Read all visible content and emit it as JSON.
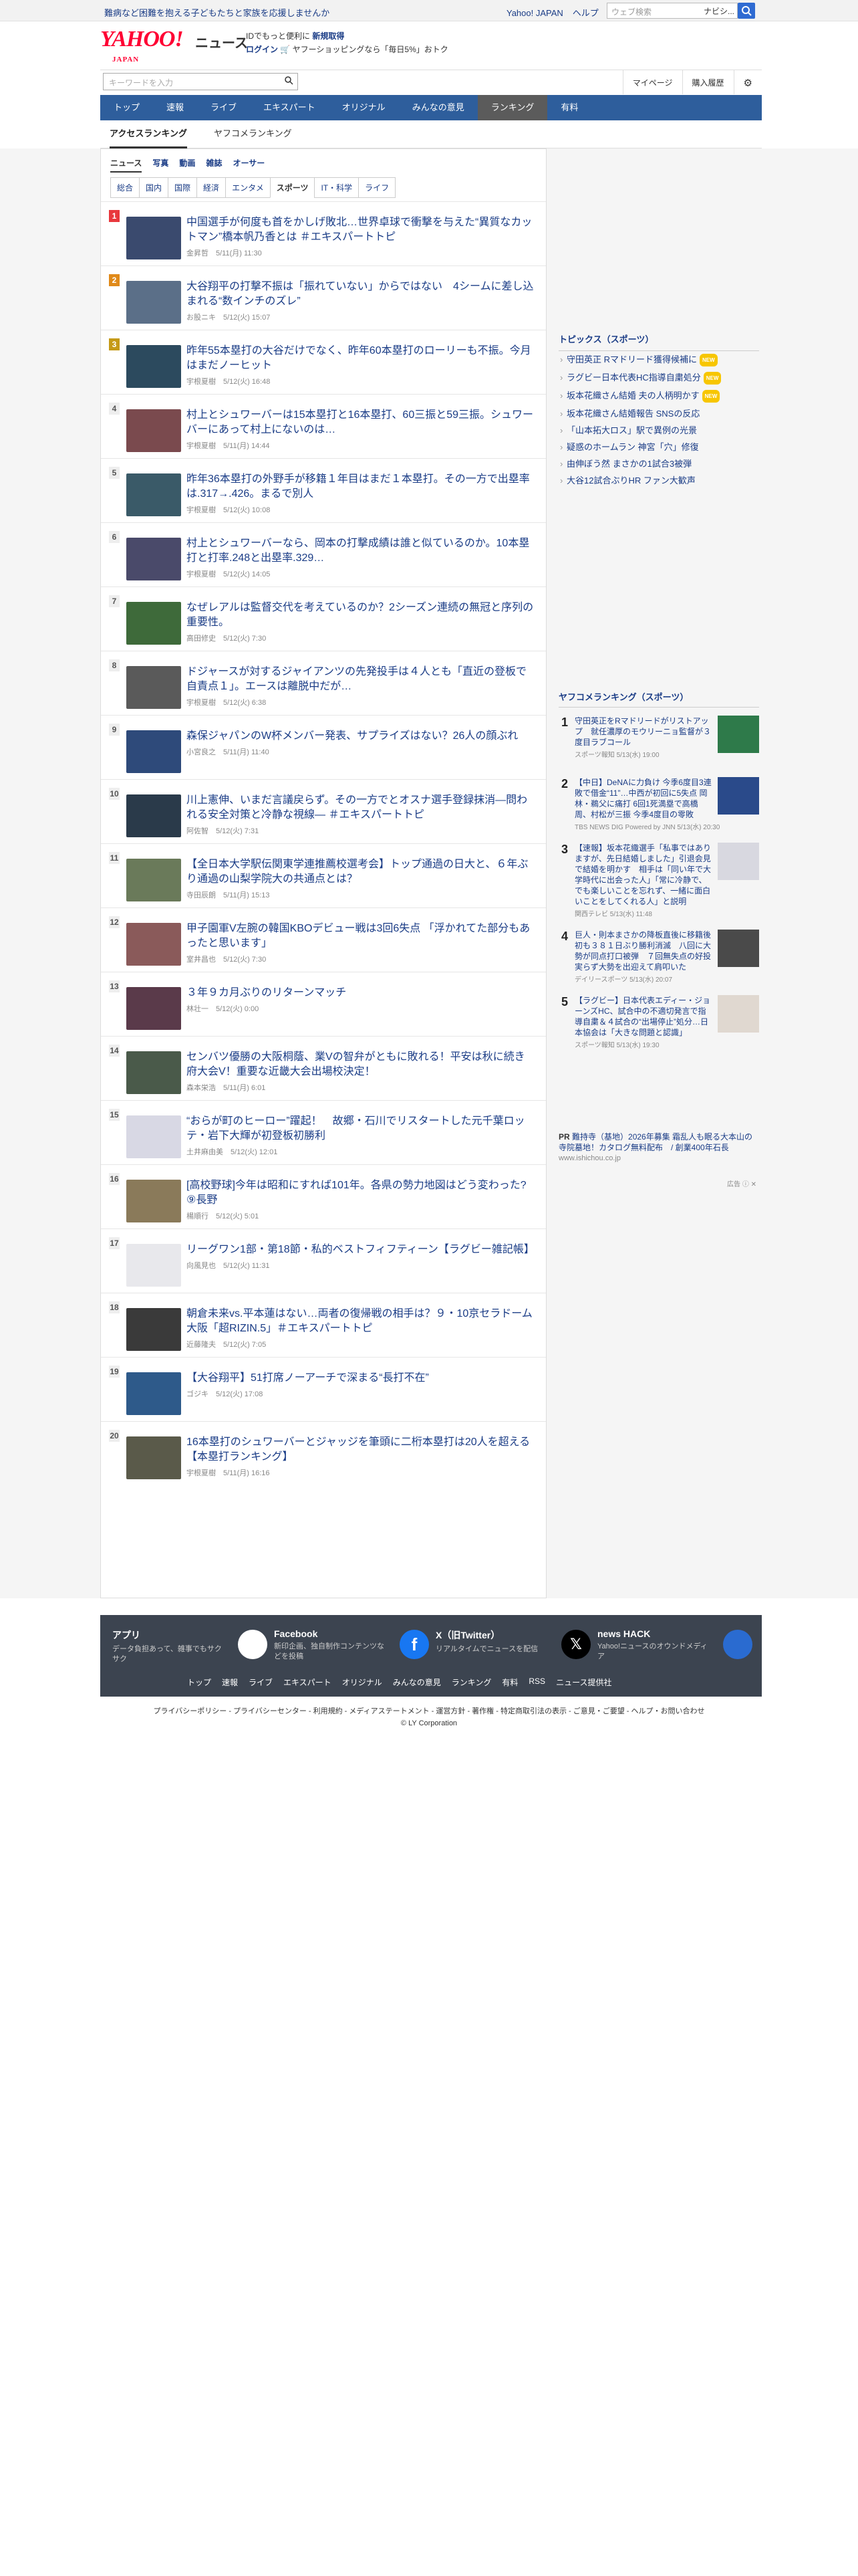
{
  "topbar": {
    "promo": "難病など困難を抱える子どもたちと家族を応援しませんか",
    "links": [
      "Yahoo! JAPAN",
      "ヘルプ"
    ],
    "search_placeholder": "ウェブ検索",
    "navi": "ナビシ..."
  },
  "header": {
    "logo": "YAHOO!",
    "logo_sub": "JAPAN",
    "news": "ニュース",
    "line1": "IDでもっと便利に",
    "line1b": "新規取得",
    "line2a": "ログイン",
    "line2b": "ヤフーショッピングなら「毎日5%」おトク"
  },
  "search": {
    "placeholder": "キーワードを入力",
    "mypage": "マイページ",
    "history": "購入履歴"
  },
  "nav": [
    "トップ",
    "速報",
    "ライブ",
    "エキスパート",
    "オリジナル",
    "みんなの意見",
    "ランキング",
    "有料"
  ],
  "subnav": [
    "アクセスランキング",
    "ヤフコメランキング"
  ],
  "rank_tabs": [
    "ニュース",
    "写真",
    "動画",
    "雑誌",
    "オーサー"
  ],
  "categories": [
    "総合",
    "国内",
    "国際",
    "経済",
    "エンタメ",
    "スポーツ",
    "IT・科学",
    "ライフ"
  ],
  "items": [
    {
      "n": "1",
      "t": "中国選手が何度も首をかしげ敗北…世界卓球で衝撃を与えた“異質なカットマン”橋本帆乃香とは ＃エキスパートトピ",
      "m": "金昇哲　5/11(月) 11:30",
      "c": "#3a4a6e"
    },
    {
      "n": "2",
      "t": "大谷翔平の打撃不振は「振れていない」からではない　4シームに差し込まれる“数インチのズレ”",
      "m": "お股ニキ　5/12(火) 15:07",
      "c": "#5b6f88"
    },
    {
      "n": "3",
      "t": "昨年55本塁打の大谷だけでなく、昨年60本塁打のローリーも不振。今月はまだノーヒット",
      "m": "宇根夏樹　5/12(火) 16:48",
      "c": "#2c4a5e"
    },
    {
      "n": "4",
      "t": "村上とシュワーバーは15本塁打と16本塁打、60三振と59三振。シュワーバーにあって村上にないのは…",
      "m": "宇根夏樹　5/11(月) 14:44",
      "c": "#7a4a4e"
    },
    {
      "n": "5",
      "t": "昨年36本塁打の外野手が移籍１年目はまだ１本塁打。その一方で出塁率は.317→.426。まるで別人",
      "m": "宇根夏樹　5/12(火) 10:08",
      "c": "#3a5a68"
    },
    {
      "n": "6",
      "t": "村上とシュワーバーなら、岡本の打撃成績は誰と似ているのか。10本塁打と打率.248と出塁率.329…",
      "m": "宇根夏樹　5/12(火) 14:05",
      "c": "#4a4a6a"
    },
    {
      "n": "7",
      "t": "なぜレアルは監督交代を考えているのか？2シーズン連続の無冠と序列の重要性。",
      "m": "高田修史　5/12(火) 7:30",
      "c": "#3e6a3a"
    },
    {
      "n": "8",
      "t": "ドジャースが対するジャイアンツの先発投手は４人とも「直近の登板で自責点１」。エースは離脱中だが…",
      "m": "宇根夏樹　5/12(火) 6:38",
      "c": "#5a5a5a"
    },
    {
      "n": "9",
      "t": "森保ジャパンのW杯メンバー発表、サプライズはない？26人の顔ぶれ",
      "m": "小宮良之　5/11(月) 11:40",
      "c": "#2e4a7a"
    },
    {
      "n": "10",
      "t": "川上憲伸、いまだ言議戻らず。その一方でとオスナ選手登録抹消―問われる安全対策と冷静な視線― ＃エキスパートトピ",
      "m": "阿佐智　5/12(火) 7:31",
      "c": "#2a3a4a"
    },
    {
      "n": "11",
      "t": "【全日本大学駅伝関東学連推薦校選考会】トップ通過の日大と、６年ぶり通過の山梨学院大の共通点とは？",
      "m": "寺田辰朗　5/11(月) 15:13",
      "c": "#6a7a5a"
    },
    {
      "n": "12",
      "t": "甲子園軍V左腕の韓国KBOデビュー戦は3回6失点 「浮かれてた部分もあったと思います」",
      "m": "室井昌也　5/12(火) 7:30",
      "c": "#8a5a5a"
    },
    {
      "n": "13",
      "t": "３年９カ月ぶりのリターンマッチ",
      "m": "林壮一　5/12(火) 0:00",
      "c": "#5a3a4a"
    },
    {
      "n": "14",
      "t": "センバツ優勝の大阪桐蔭、業Vの智弁がともに敗れる！平安は秋に続き府大会V！重要な近畿大会出場校決定！",
      "m": "森本栄浩　5/11(月) 6:01",
      "c": "#4a5a4a"
    },
    {
      "n": "15",
      "t": "“おらが町のヒーロー”躍起！　故郷・石川でリスタートした元千葉ロッテ・岩下大輝が初登板初勝利",
      "m": "土井麻由美　5/12(火) 12:01",
      "c": "#d8d8e4"
    },
    {
      "n": "16",
      "t": "[高校野球]今年は昭和にすれば101年。各県の勢力地図はどう変わった?⑨長野",
      "m": "楊順行　5/12(火) 5:01",
      "c": "#8a7a5a"
    },
    {
      "n": "17",
      "t": "リーグワン1部・第18節・私的ベストフィフティーン【ラグビー雑記帳】",
      "m": "向風見也　5/12(火) 11:31",
      "c": "#e8e8ec"
    },
    {
      "n": "18",
      "t": "朝倉未来vs.平本蓮はない…両者の復帰戦の相手は？９・10京セラドーム大阪「超RIZIN.5」＃エキスパートトピ",
      "m": "近藤隆夫　5/12(火) 7:05",
      "c": "#3a3a3a"
    },
    {
      "n": "19",
      "t": "【大谷翔平】51打席ノーアーチで深まる“長打不在”",
      "m": "ゴジキ　5/12(火) 17:08",
      "c": "#2e5a8a"
    },
    {
      "n": "20",
      "t": "16本塁打のシュワーバーとジャッジを筆頭に二桁本塁打は20人を超える【本塁打ランキング】",
      "m": "宇根夏樹　5/11(月) 16:16",
      "c": "#5a5a4a"
    }
  ],
  "topics": {
    "title": "トピックス（スポーツ）",
    "items": [
      {
        "t": "守田英正 Rマドリード獲得候補に",
        "new": true
      },
      {
        "t": "ラグビー日本代表HC指導自粛処分",
        "new": true
      },
      {
        "t": "坂本花織さん結婚 夫の人柄明かす",
        "new": true
      },
      {
        "t": "坂本花織さん結婚報告 SNSの反応",
        "new": false
      },
      {
        "t": "「山本拓大ロス」駅で異例の光景",
        "new": false
      },
      {
        "t": "疑惑のホームラン 神宮「穴」修復",
        "new": false
      },
      {
        "t": "由伸ぼう然 まさかの1試合3被弾",
        "new": false
      },
      {
        "t": "大谷12試合ぶりHR ファン大歓声",
        "new": false
      }
    ],
    "new_label": "NEW"
  },
  "yrank": {
    "title": "ヤフコメランキング（スポーツ）",
    "items": [
      {
        "n": "1",
        "t": "守田英正をRマドリードがリストアップ　就任濃厚のモウリーニョ監督が３度目ラブコール",
        "s": "スポーツ報知 5/13(水) 19:00",
        "c": "#2e7a4a"
      },
      {
        "n": "2",
        "t": "【中日】DeNAに力負け 今季6度目3連敗で借金“11”…中西が初回に5失点 岡林・鵜父に痛打 6回1死満塁で高橋周、村松が三振 今季4度目の零敗",
        "s": "TBS NEWS DIG Powered by JNN 5/13(水) 20:30",
        "c": "#2a4a8a"
      },
      {
        "n": "3",
        "t": "【速報】坂本花織選手「私事ではありますが、先日結婚しました」引退会見で結婚を明かす　相手は「同い年で大学時代に出会った人」「常に冷静で、でも楽しいことを忘れず、一緒に面白いことをしてくれる人」と説明",
        "s": "関西テレビ 5/13(水) 11:48",
        "c": "#d8d8e0"
      },
      {
        "n": "4",
        "t": "巨人・則本まさかの降板直後に移籍後初も３８１日ぶり勝利消滅　八回に大勢が同点打口被弾　７回無失点の好投実らず大勢を出迎えて肩叩いた",
        "s": "デイリースポーツ 5/13(水) 20:07",
        "c": "#4a4a4a"
      },
      {
        "n": "5",
        "t": "【ラグビー】日本代表エディー・ジョーンズHC、試合中の不適切発言で指導自粛＆４試合の“出場停止”処分…日本協会は「大きな問題と認識」",
        "s": "スポーツ報知 5/13(水) 19:30",
        "c": "#e0d8d0"
      }
    ]
  },
  "pr": {
    "label": "PR",
    "text": "難持寺（基地）2026年募集 霜乱人も眠る大本山の寺院墓地！カタログ無料配布　/ 創業400年石長",
    "url": "www.ishichou.co.jp",
    "ad": "広告"
  },
  "footer": {
    "boxes": [
      {
        "t": "アプリ",
        "d": "データ負担あって、雑事でもサクサク"
      },
      {
        "t": "Facebook",
        "d": "新印企画、独自制作コンテンツなどを投稿"
      },
      {
        "t": "X（旧Twitter）",
        "d": "リアルタイムでニュースを配信"
      },
      {
        "t": "news HACK",
        "d": "Yahoo!ニュースのオウンドメディア"
      }
    ],
    "links": [
      "トップ",
      "速報",
      "ライブ",
      "エキスパート",
      "オリジナル",
      "みんなの意見",
      "ランキング",
      "有料",
      "RSS",
      "ニュース提供社"
    ],
    "legal": "プライバシーポリシー - プライバシーセンター - 利用規約 - メディアステートメント - 運営方針 - 著作権 - 特定商取引法の表示 - ご意見・ご要望 - ヘルプ・お問い合わせ",
    "copy": "© LY Corporation"
  }
}
